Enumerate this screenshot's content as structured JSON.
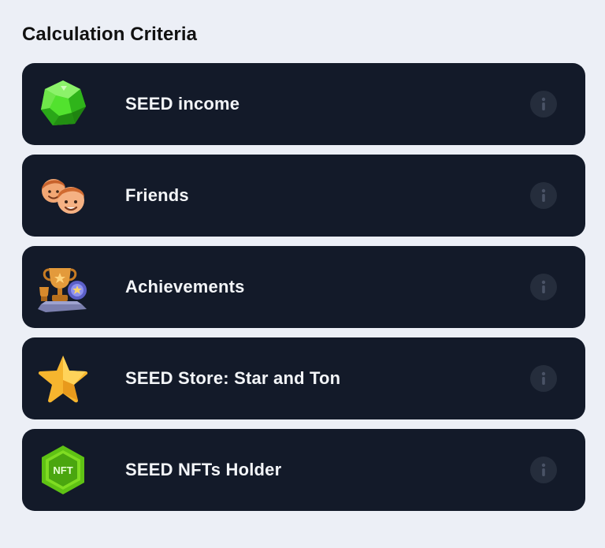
{
  "section": {
    "title": "Calculation Criteria"
  },
  "criteria": [
    {
      "label": "SEED income",
      "icon": "green-gem-icon"
    },
    {
      "label": "Friends",
      "icon": "friends-faces-icon"
    },
    {
      "label": "Achievements",
      "icon": "trophy-medal-icon"
    },
    {
      "label": "SEED Store: Star and Ton",
      "icon": "star-icon"
    },
    {
      "label": "SEED NFTs Holder",
      "icon": "nft-hexagon-icon",
      "badge_text": "NFT"
    }
  ],
  "info_icon": "info-icon",
  "colors": {
    "background": "#eceff6",
    "card": "#131a29",
    "card_text": "#f3f5f8",
    "info_circle": "#252d3c",
    "info_glyph": "#4a5366"
  }
}
